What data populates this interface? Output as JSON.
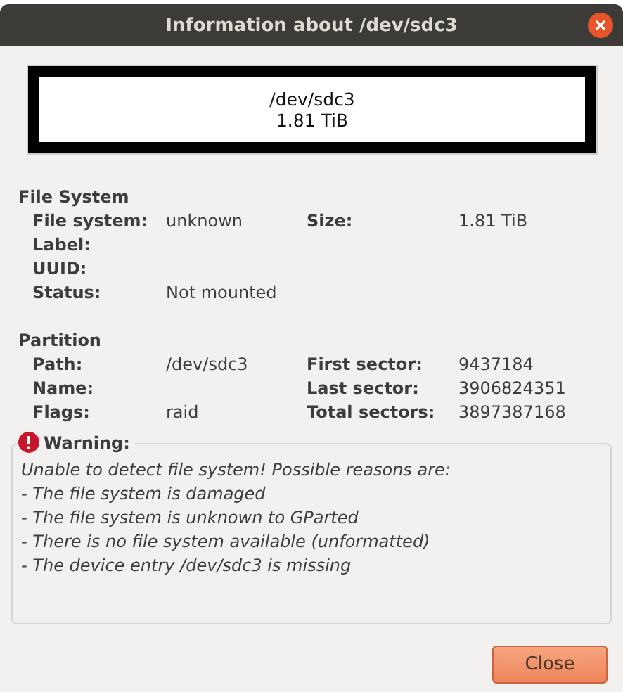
{
  "window": {
    "title": "Information about /dev/sdc3"
  },
  "partition_graphic": {
    "path": "/dev/sdc3",
    "size": "1.81 TiB"
  },
  "sections": [
    {
      "title": "File System",
      "rows": [
        {
          "label": "File system:",
          "value": "unknown",
          "label_2": "Size:",
          "value_2": "1.81 TiB"
        },
        {
          "label": "Label:"
        },
        {
          "label": "UUID:"
        },
        {
          "label": "Status:",
          "value": "Not mounted"
        }
      ]
    },
    {
      "title": "Partition",
      "rows": [
        {
          "label": "Path:",
          "value": "/dev/sdc3",
          "label_2": "First sector:",
          "value_2": "9437184"
        },
        {
          "label": "Name:",
          "label_2": "Last sector:",
          "value_2": "3906824351"
        },
        {
          "label": "Flags:",
          "value": "raid",
          "label_2": "Total sectors:",
          "value_2": "3897387168"
        }
      ]
    }
  ],
  "warning": {
    "title": "Warning:",
    "lines": [
      "Unable to detect file system! Possible reasons are:",
      "- The file system is damaged",
      "- The file system is unknown to GParted",
      "- There is no file system available (unformatted)",
      "- The device entry /dev/sdc3 is missing"
    ]
  },
  "buttons": [
    "Close"
  ]
}
